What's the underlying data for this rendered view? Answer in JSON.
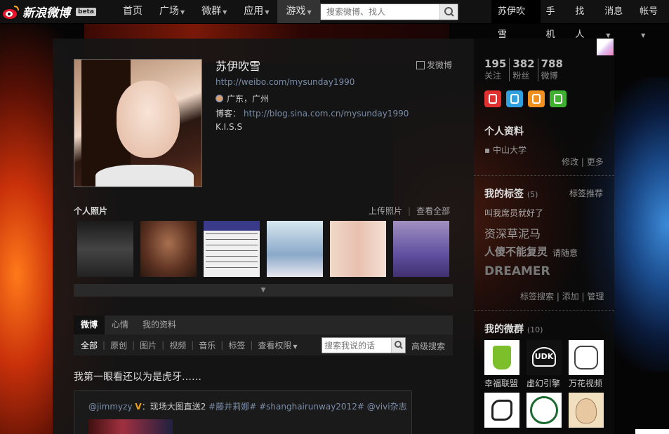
{
  "topbar": {
    "logo_text": "新浪微博",
    "beta": "beta",
    "nav": [
      "首页",
      "广场",
      "微群",
      "应用",
      "游戏"
    ],
    "search_placeholder": "搜索微博、找人",
    "user": "苏伊吹雪",
    "right_nav": [
      "手机",
      "找人",
      "消息",
      "帐号"
    ]
  },
  "profile": {
    "name": "苏伊吹雪",
    "post_button": "发微博",
    "url": "http://weibo.com/mysunday1990",
    "location": "广东，广州",
    "blog_label": "博客：",
    "blog_url": "http://blog.sina.com.cn/mysunday1990",
    "description": "K.I.S.S"
  },
  "photos": {
    "title": "个人照片",
    "upload": "上传照片",
    "view_all": "查看全部"
  },
  "tabs": [
    "微博",
    "心情",
    "我的资料"
  ],
  "subtabs": [
    "全部",
    "原创",
    "图片",
    "视频",
    "音乐",
    "标签",
    "查看权限"
  ],
  "search_mine_placeholder": "搜索我说的话",
  "advanced_search": "高级搜索",
  "post": {
    "text": "我第一眼看还以为是虎牙……",
    "repost_user": "@jimmyzy",
    "repost_sep": "：",
    "repost_text": "现场大图直送2",
    "repost_tags": "#藤井莉娜# #shanghairunway2012# @vivi杂志"
  },
  "stats": [
    {
      "n": "195",
      "l": "关注"
    },
    {
      "n": "382",
      "l": "粉丝"
    },
    {
      "n": "788",
      "l": "微博"
    }
  ],
  "sidebar": {
    "profile_title": "个人资料",
    "school": "▪ 中山大学",
    "edit": "修改",
    "more": "更多",
    "tags_title": "我的标签",
    "tags_count": "(5)",
    "tag_recommend": "标签推荐",
    "tags": [
      "叫我席员就好了",
      "资深草泥马",
      "人傻不能复灵",
      "请随意",
      "DREAMER"
    ],
    "tag_search": "标签搜索",
    "tag_add": "添加",
    "tag_manage": "管理",
    "groups_title": "我的微群",
    "groups_count": "(10)",
    "groups": [
      "幸福联盟",
      "虚幻引擎",
      "万花视频",
      "",
      "",
      ""
    ],
    "udk": "UDK"
  },
  "colors": {
    "link": "#7a8ca8",
    "topbar": "#121212",
    "panel": "#161616"
  }
}
